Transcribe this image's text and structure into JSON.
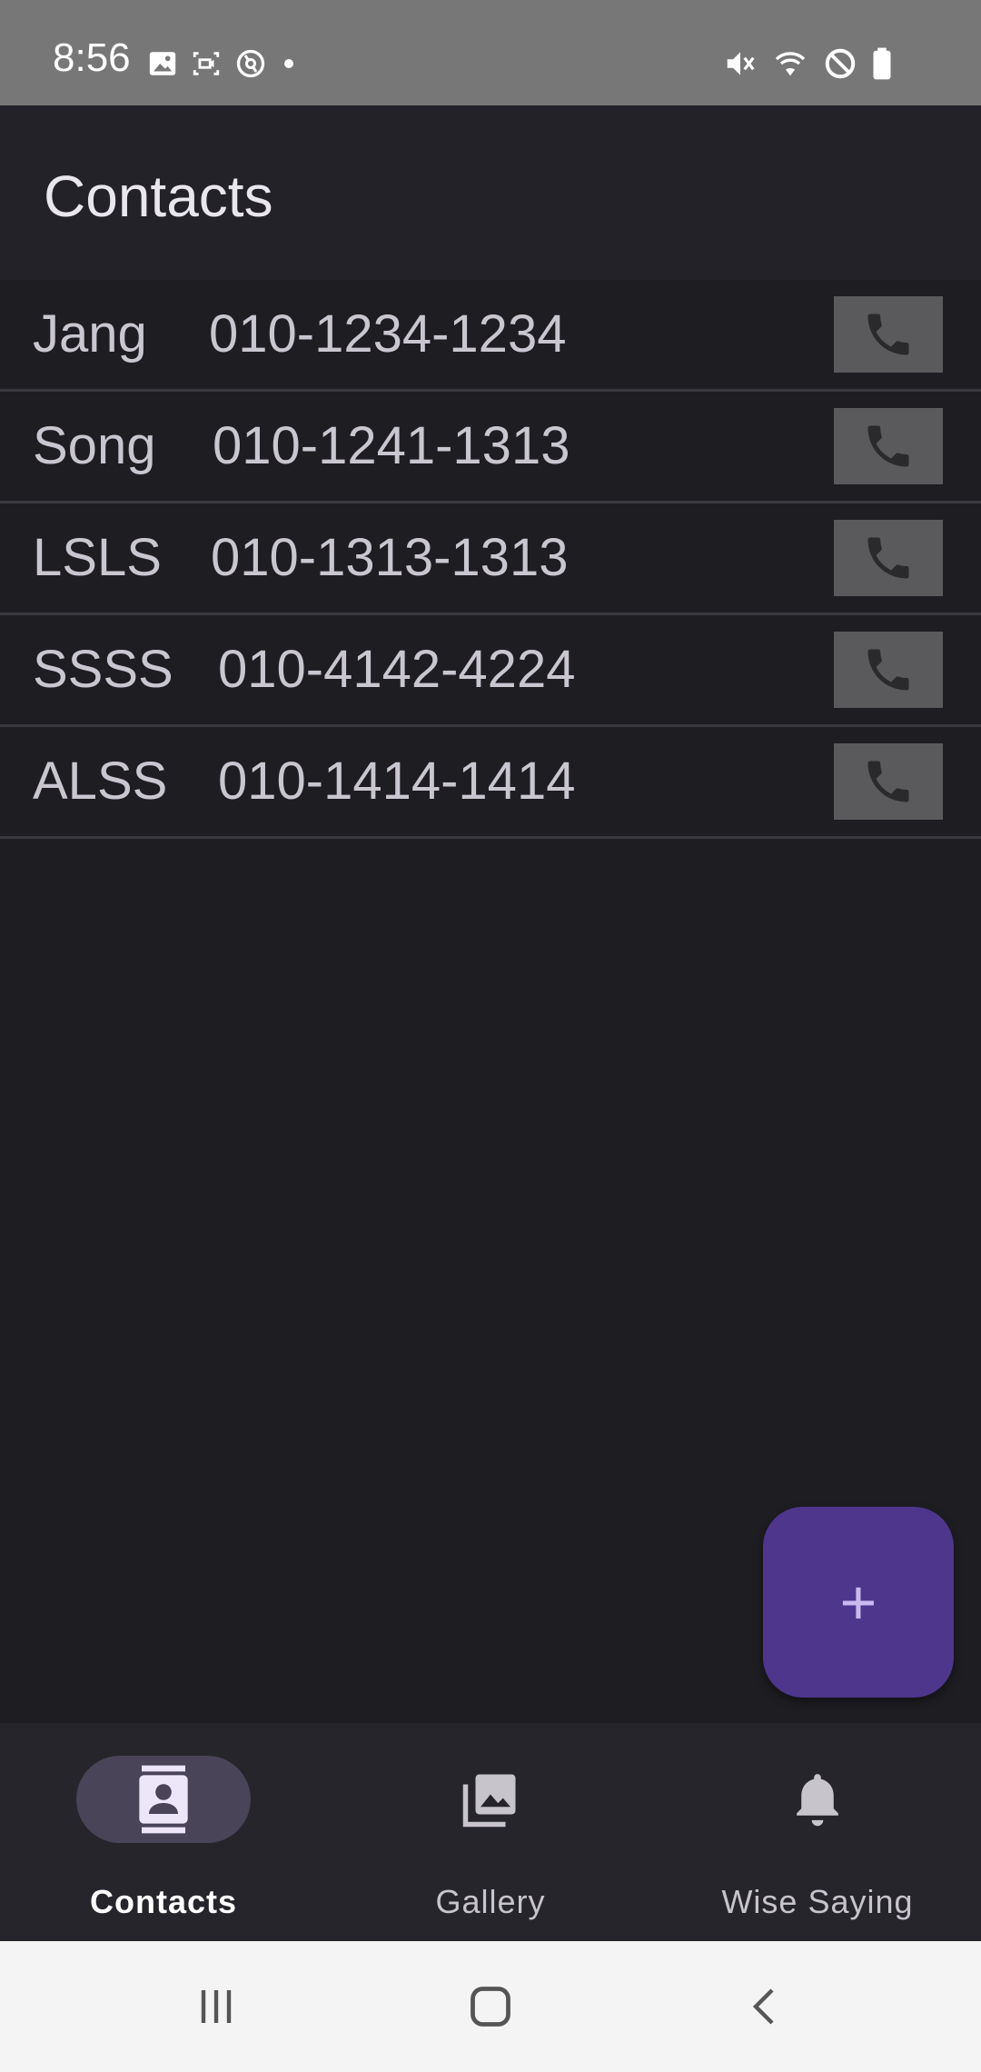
{
  "status_bar": {
    "time": "8:56",
    "left_icons": [
      "image-icon",
      "screen-record-icon",
      "sync-icon",
      "dot-icon"
    ],
    "right_icons": [
      "mute-icon",
      "wifi-icon",
      "do-not-disturb-icon",
      "battery-icon"
    ]
  },
  "app_bar": {
    "title": "Contacts"
  },
  "contacts": [
    {
      "name": "Jang",
      "phone": "010-1234-1234"
    },
    {
      "name": "Song",
      "phone": "010-1241-1313"
    },
    {
      "name": "LSLS",
      "phone": "010-1313-1313"
    },
    {
      "name": "SSSS",
      "phone": "010-4142-4224"
    },
    {
      "name": "ALSS",
      "phone": "010-1414-1414"
    }
  ],
  "fab": {
    "label": "+"
  },
  "bottom_nav": {
    "items": [
      {
        "label": "Contacts",
        "icon": "contacts-icon",
        "active": true
      },
      {
        "label": "Gallery",
        "icon": "gallery-icon",
        "active": false
      },
      {
        "label": "Wise Saying",
        "icon": "bell-icon",
        "active": false
      }
    ]
  },
  "colors": {
    "background": "#1e1d22",
    "app_bar": "#232228",
    "status_bar": "#777777",
    "fab": "#4d368c",
    "call_button": "#5a5a5c",
    "nav_indicator": "#4a4458"
  }
}
